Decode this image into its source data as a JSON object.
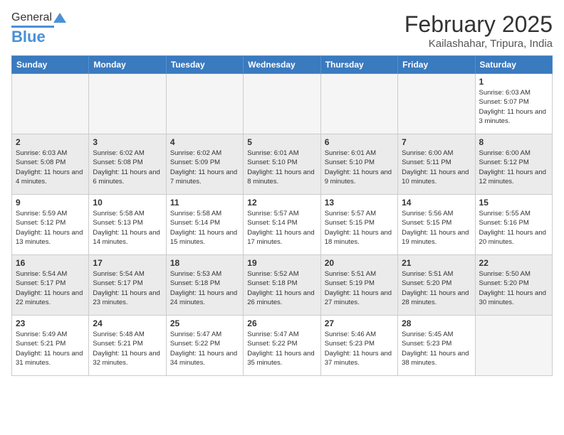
{
  "header": {
    "logo_general": "General",
    "logo_blue": "Blue",
    "month_title": "February 2025",
    "subtitle": "Kailashahar, Tripura, India"
  },
  "days_of_week": [
    "Sunday",
    "Monday",
    "Tuesday",
    "Wednesday",
    "Thursday",
    "Friday",
    "Saturday"
  ],
  "weeks": [
    [
      {
        "num": "",
        "info": ""
      },
      {
        "num": "",
        "info": ""
      },
      {
        "num": "",
        "info": ""
      },
      {
        "num": "",
        "info": ""
      },
      {
        "num": "",
        "info": ""
      },
      {
        "num": "",
        "info": ""
      },
      {
        "num": "1",
        "info": "Sunrise: 6:03 AM\nSunset: 5:07 PM\nDaylight: 11 hours and 3 minutes."
      }
    ],
    [
      {
        "num": "2",
        "info": "Sunrise: 6:03 AM\nSunset: 5:08 PM\nDaylight: 11 hours and 4 minutes."
      },
      {
        "num": "3",
        "info": "Sunrise: 6:02 AM\nSunset: 5:08 PM\nDaylight: 11 hours and 6 minutes."
      },
      {
        "num": "4",
        "info": "Sunrise: 6:02 AM\nSunset: 5:09 PM\nDaylight: 11 hours and 7 minutes."
      },
      {
        "num": "5",
        "info": "Sunrise: 6:01 AM\nSunset: 5:10 PM\nDaylight: 11 hours and 8 minutes."
      },
      {
        "num": "6",
        "info": "Sunrise: 6:01 AM\nSunset: 5:10 PM\nDaylight: 11 hours and 9 minutes."
      },
      {
        "num": "7",
        "info": "Sunrise: 6:00 AM\nSunset: 5:11 PM\nDaylight: 11 hours and 10 minutes."
      },
      {
        "num": "8",
        "info": "Sunrise: 6:00 AM\nSunset: 5:12 PM\nDaylight: 11 hours and 12 minutes."
      }
    ],
    [
      {
        "num": "9",
        "info": "Sunrise: 5:59 AM\nSunset: 5:12 PM\nDaylight: 11 hours and 13 minutes."
      },
      {
        "num": "10",
        "info": "Sunrise: 5:58 AM\nSunset: 5:13 PM\nDaylight: 11 hours and 14 minutes."
      },
      {
        "num": "11",
        "info": "Sunrise: 5:58 AM\nSunset: 5:14 PM\nDaylight: 11 hours and 15 minutes."
      },
      {
        "num": "12",
        "info": "Sunrise: 5:57 AM\nSunset: 5:14 PM\nDaylight: 11 hours and 17 minutes."
      },
      {
        "num": "13",
        "info": "Sunrise: 5:57 AM\nSunset: 5:15 PM\nDaylight: 11 hours and 18 minutes."
      },
      {
        "num": "14",
        "info": "Sunrise: 5:56 AM\nSunset: 5:15 PM\nDaylight: 11 hours and 19 minutes."
      },
      {
        "num": "15",
        "info": "Sunrise: 5:55 AM\nSunset: 5:16 PM\nDaylight: 11 hours and 20 minutes."
      }
    ],
    [
      {
        "num": "16",
        "info": "Sunrise: 5:54 AM\nSunset: 5:17 PM\nDaylight: 11 hours and 22 minutes."
      },
      {
        "num": "17",
        "info": "Sunrise: 5:54 AM\nSunset: 5:17 PM\nDaylight: 11 hours and 23 minutes."
      },
      {
        "num": "18",
        "info": "Sunrise: 5:53 AM\nSunset: 5:18 PM\nDaylight: 11 hours and 24 minutes."
      },
      {
        "num": "19",
        "info": "Sunrise: 5:52 AM\nSunset: 5:18 PM\nDaylight: 11 hours and 26 minutes."
      },
      {
        "num": "20",
        "info": "Sunrise: 5:51 AM\nSunset: 5:19 PM\nDaylight: 11 hours and 27 minutes."
      },
      {
        "num": "21",
        "info": "Sunrise: 5:51 AM\nSunset: 5:20 PM\nDaylight: 11 hours and 28 minutes."
      },
      {
        "num": "22",
        "info": "Sunrise: 5:50 AM\nSunset: 5:20 PM\nDaylight: 11 hours and 30 minutes."
      }
    ],
    [
      {
        "num": "23",
        "info": "Sunrise: 5:49 AM\nSunset: 5:21 PM\nDaylight: 11 hours and 31 minutes."
      },
      {
        "num": "24",
        "info": "Sunrise: 5:48 AM\nSunset: 5:21 PM\nDaylight: 11 hours and 32 minutes."
      },
      {
        "num": "25",
        "info": "Sunrise: 5:47 AM\nSunset: 5:22 PM\nDaylight: 11 hours and 34 minutes."
      },
      {
        "num": "26",
        "info": "Sunrise: 5:47 AM\nSunset: 5:22 PM\nDaylight: 11 hours and 35 minutes."
      },
      {
        "num": "27",
        "info": "Sunrise: 5:46 AM\nSunset: 5:23 PM\nDaylight: 11 hours and 37 minutes."
      },
      {
        "num": "28",
        "info": "Sunrise: 5:45 AM\nSunset: 5:23 PM\nDaylight: 11 hours and 38 minutes."
      },
      {
        "num": "",
        "info": ""
      }
    ]
  ]
}
